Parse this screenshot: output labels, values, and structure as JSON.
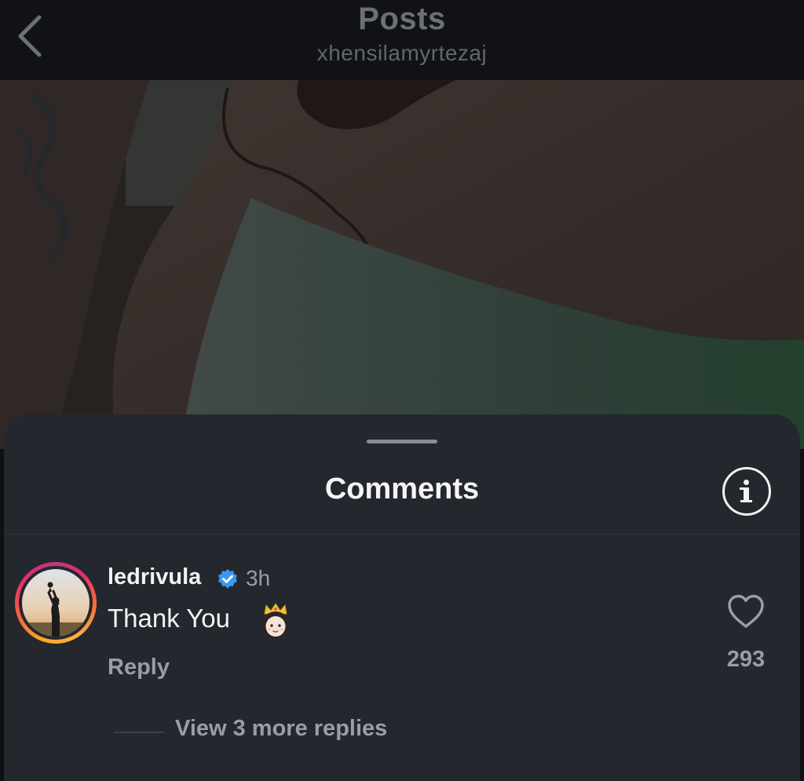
{
  "header": {
    "title": "Posts",
    "subtitle": "xhensilamyrtezaj"
  },
  "sheet": {
    "title": "Comments"
  },
  "comment": {
    "username": "ledrivula",
    "verified": true,
    "time": "3h",
    "text": "Thank You",
    "emoji": "princess-with-crown",
    "reply_label": "Reply",
    "like_count": "293",
    "view_replies_label": "View 3 more replies"
  },
  "colors": {
    "background": "#0e1014",
    "sheet": "#24272d",
    "verified": "#3897f0",
    "muted_text": "#9a9da3"
  },
  "icons": {
    "back": "chevron-left-icon",
    "info": "info-icon",
    "verified": "verified-badge-icon",
    "like": "heart-icon"
  }
}
